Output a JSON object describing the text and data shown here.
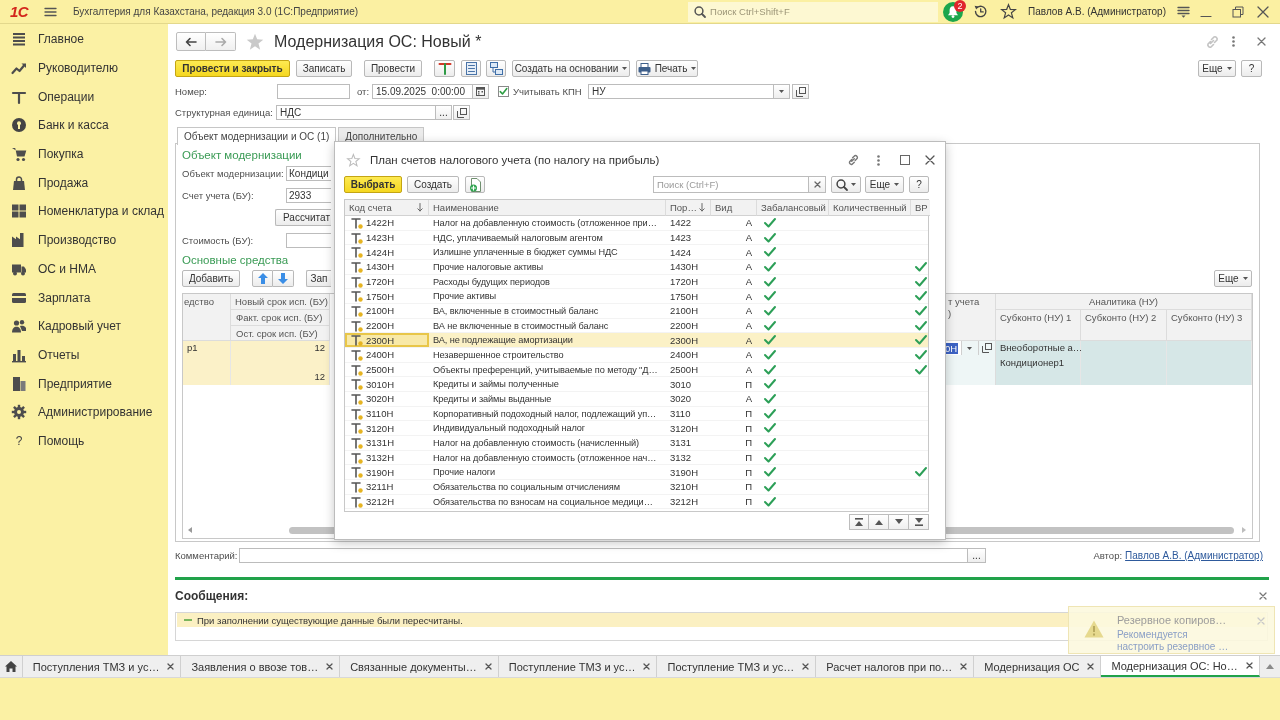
{
  "top_bar": {
    "logo": "1С",
    "title": "Бухгалтерия для Казахстана, редакция 3.0 (1С:Предприятие)",
    "search": {
      "placeholder": "Поиск Ctrl+Shift+F"
    },
    "notifications": "2",
    "user": "Павлов А.В. (Администратор)"
  },
  "sidebar": {
    "items": [
      {
        "label": "Главное",
        "selected": false
      },
      {
        "label": "Руководителю",
        "selected": false
      },
      {
        "label": "Операции",
        "selected": false
      },
      {
        "label": "Банк и касса",
        "selected": false
      },
      {
        "label": "Покупка",
        "selected": false
      },
      {
        "label": "Продажа",
        "selected": false
      },
      {
        "label": "Номенклатура и склад",
        "selected": false
      },
      {
        "label": "Производство",
        "selected": false
      },
      {
        "label": "ОС и НМА",
        "selected": false
      },
      {
        "label": "Зарплата",
        "selected": false
      },
      {
        "label": "Кадровый учет",
        "selected": false
      },
      {
        "label": "Отчеты",
        "selected": false
      },
      {
        "label": "Предприятие",
        "selected": false
      },
      {
        "label": "Администрирование",
        "selected": false
      },
      {
        "label": "Помощь",
        "glyph": "?",
        "selected": false
      }
    ]
  },
  "document": {
    "title": "Модернизация ОС: Новый *",
    "commands": {
      "post_and_close": "Провести и закрыть",
      "save": "Записать",
      "post": "Провести",
      "create_based_on": "Создать на основании",
      "print": "Печать",
      "more": "Еще",
      "help": "?"
    },
    "number": {
      "label": "Номер:"
    },
    "date": {
      "label": "от:",
      "value": "15.09.2025  0:00:00"
    },
    "kpn": {
      "label": "Учитывать КПН",
      "checked": true
    },
    "kpn_register": {
      "value": "НУ"
    },
    "structural_unit": {
      "label": "Структурная единица:",
      "value": "НДС",
      "choose": "..."
    },
    "tabs": [
      {
        "label": "Объект модернизации и ОС (1)",
        "selected": true
      },
      {
        "label": "Дополнительно",
        "selected": false
      }
    ],
    "modernization": {
      "heading": "Объект модернизации",
      "fields": [
        {
          "label": "Объект модернизации:",
          "value": "Кондици"
        },
        {
          "label": "Счет учета (БУ):",
          "value": "2933"
        }
      ],
      "calculate": "Рассчитат",
      "cost": {
        "label": "Стоимость (БУ):"
      }
    },
    "fixed_assets": {
      "heading": "Основные средства",
      "add": "Добавить",
      "fill": "Зап",
      "more": "Еще",
      "table": {
        "header": {
          "column_1": "едство",
          "new_term": "Новый срок исп. (БУ)",
          "actual_term": "Факт. срок исп. (БУ)",
          "remaining_term": "Ост. срок исп. (БУ)",
          "account": [
            "т учета",
            ")"
          ],
          "analytics": "Аналитика (НУ)",
          "subconto": [
            "Субконто (НУ) 1",
            "Субконто (НУ) 2",
            "Субконто (НУ) 3"
          ]
        },
        "rows": [
          {
            "column_1": "р1",
            "new_term": "12",
            "remaining_term": "12",
            "account": "0Н",
            "subconto_1_type": "Внеоборотные а…",
            "subconto_1": "Кондиционер1",
            "selected": true
          }
        ]
      }
    },
    "comment": {
      "label": "Комментарий:",
      "choose": "..."
    },
    "author": {
      "label": "Автор:",
      "value": "Павлов А.В. (Администратор)"
    }
  },
  "dialog": {
    "title": "План счетов налогового учета (по налогу на прибыль)",
    "choose": "Выбрать",
    "create": "Создать",
    "search": {
      "placeholder": "Поиск (Ctrl+F)"
    },
    "more": "Еще",
    "help": "?",
    "table": {
      "columns": [
        {
          "label": "Код счета",
          "sorted": true
        },
        {
          "label": "Наименование",
          "sorted": false
        },
        {
          "label": "Пор…",
          "sorted": true
        },
        {
          "label": "Вид",
          "sorted": false
        },
        {
          "label": "Забалансовый",
          "sorted": false
        },
        {
          "label": "Количественный",
          "sorted": false
        },
        {
          "label": "ВР",
          "sorted": false
        }
      ],
      "rows": [
        {
          "code": "1422Н",
          "name": "Налог на добавленную стоимость (отложенное при…",
          "order": "1422",
          "type": "А",
          "off_balance": true,
          "quantitative": false,
          "vr": false,
          "selected": false
        },
        {
          "code": "1423Н",
          "name": "НДС, уплачиваемый налоговым агентом",
          "order": "1423",
          "type": "А",
          "off_balance": true,
          "quantitative": false,
          "vr": false,
          "selected": false
        },
        {
          "code": "1424Н",
          "name": "Излишне уплаченные в бюджет суммы НДС",
          "order": "1424",
          "type": "А",
          "off_balance": true,
          "quantitative": false,
          "vr": false,
          "selected": false
        },
        {
          "code": "1430Н",
          "name": "Прочие налоговые активы",
          "order": "1430Н",
          "type": "А",
          "off_balance": true,
          "quantitative": false,
          "vr": true,
          "selected": false
        },
        {
          "code": "1720Н",
          "name": "Расходы будущих периодов",
          "order": "1720Н",
          "type": "А",
          "off_balance": true,
          "quantitative": false,
          "vr": true,
          "selected": false
        },
        {
          "code": "1750Н",
          "name": "Прочие активы",
          "order": "1750Н",
          "type": "А",
          "off_balance": true,
          "quantitative": false,
          "vr": true,
          "selected": false
        },
        {
          "code": "2100Н",
          "name": "ВА, включенные в стоимостный баланс",
          "order": "2100Н",
          "type": "А",
          "off_balance": true,
          "quantitative": false,
          "vr": true,
          "selected": false
        },
        {
          "code": "2200Н",
          "name": "ВА не включенные в стоимостный баланс",
          "order": "2200Н",
          "type": "А",
          "off_balance": true,
          "quantitative": false,
          "vr": true,
          "selected": false
        },
        {
          "code": "2300Н",
          "name": "ВА, не подлежащие амортизации",
          "order": "2300Н",
          "type": "А",
          "off_balance": true,
          "quantitative": false,
          "vr": true,
          "selected": true
        },
        {
          "code": "2400Н",
          "name": "Незавершенное строительство",
          "order": "2400Н",
          "type": "А",
          "off_balance": true,
          "quantitative": false,
          "vr": true,
          "selected": false
        },
        {
          "code": "2500Н",
          "name": "Объекты преференций, учитываемые по методу \"Д…",
          "order": "2500Н",
          "type": "А",
          "off_balance": true,
          "quantitative": false,
          "vr": true,
          "selected": false
        },
        {
          "code": "3010Н",
          "name": "Кредиты и займы полученные",
          "order": "3010",
          "type": "П",
          "off_balance": true,
          "quantitative": false,
          "vr": false,
          "selected": false
        },
        {
          "code": "3020Н",
          "name": "Кредиты и займы выданные",
          "order": "3020",
          "type": "А",
          "off_balance": true,
          "quantitative": false,
          "vr": false,
          "selected": false
        },
        {
          "code": "3110Н",
          "name": "Корпоративный подоходный налог, подлежащий уп…",
          "order": "3110",
          "type": "П",
          "off_balance": true,
          "quantitative": false,
          "vr": false,
          "selected": false
        },
        {
          "code": "3120Н",
          "name": "Индивидуальный подоходный налог",
          "order": "3120Н",
          "type": "П",
          "off_balance": true,
          "quantitative": false,
          "vr": false,
          "selected": false
        },
        {
          "code": "3131Н",
          "name": "Налог на добавленную стоимость (начисленный)",
          "order": "3131",
          "type": "П",
          "off_balance": true,
          "quantitative": false,
          "vr": false,
          "selected": false
        },
        {
          "code": "3132Н",
          "name": "Налог на добавленную стоимость (отложенное нач…",
          "order": "3132",
          "type": "П",
          "off_balance": true,
          "quantitative": false,
          "vr": false,
          "selected": false
        },
        {
          "code": "3190Н",
          "name": "Прочие налоги",
          "order": "3190Н",
          "type": "П",
          "off_balance": true,
          "quantitative": false,
          "vr": true,
          "selected": false
        },
        {
          "code": "3211Н",
          "name": "Обязательства по социальным отчислениям",
          "order": "3210Н",
          "type": "П",
          "off_balance": true,
          "quantitative": false,
          "vr": false,
          "selected": false
        },
        {
          "code": "3212Н",
          "name": "Обязательства по взносам на социальное медици…",
          "order": "3212Н",
          "type": "П",
          "off_balance": true,
          "quantitative": false,
          "vr": false,
          "selected": false
        }
      ]
    }
  },
  "messages": {
    "title": "Сообщения:",
    "items": [
      "При заполнении существующие данные были пересчитаны."
    ]
  },
  "taskbar": {
    "tabs": [
      {
        "label": "Поступления ТМЗ и ус…",
        "selected": false
      },
      {
        "label": "Заявления о ввозе тов…",
        "selected": false
      },
      {
        "label": "Связанные документы…",
        "selected": false
      },
      {
        "label": "Поступление ТМЗ и ус…",
        "selected": false
      },
      {
        "label": "Поступление ТМЗ и ус…",
        "selected": false
      },
      {
        "label": "Расчет налогов при по…",
        "selected": false
      },
      {
        "label": "Модернизация ОС",
        "selected": false
      },
      {
        "label": "Модернизация ОС: Но…",
        "selected": true
      }
    ]
  },
  "notification": {
    "title": "Резервное копиров…",
    "text": "Рекомендуется настроить резервное …"
  }
}
